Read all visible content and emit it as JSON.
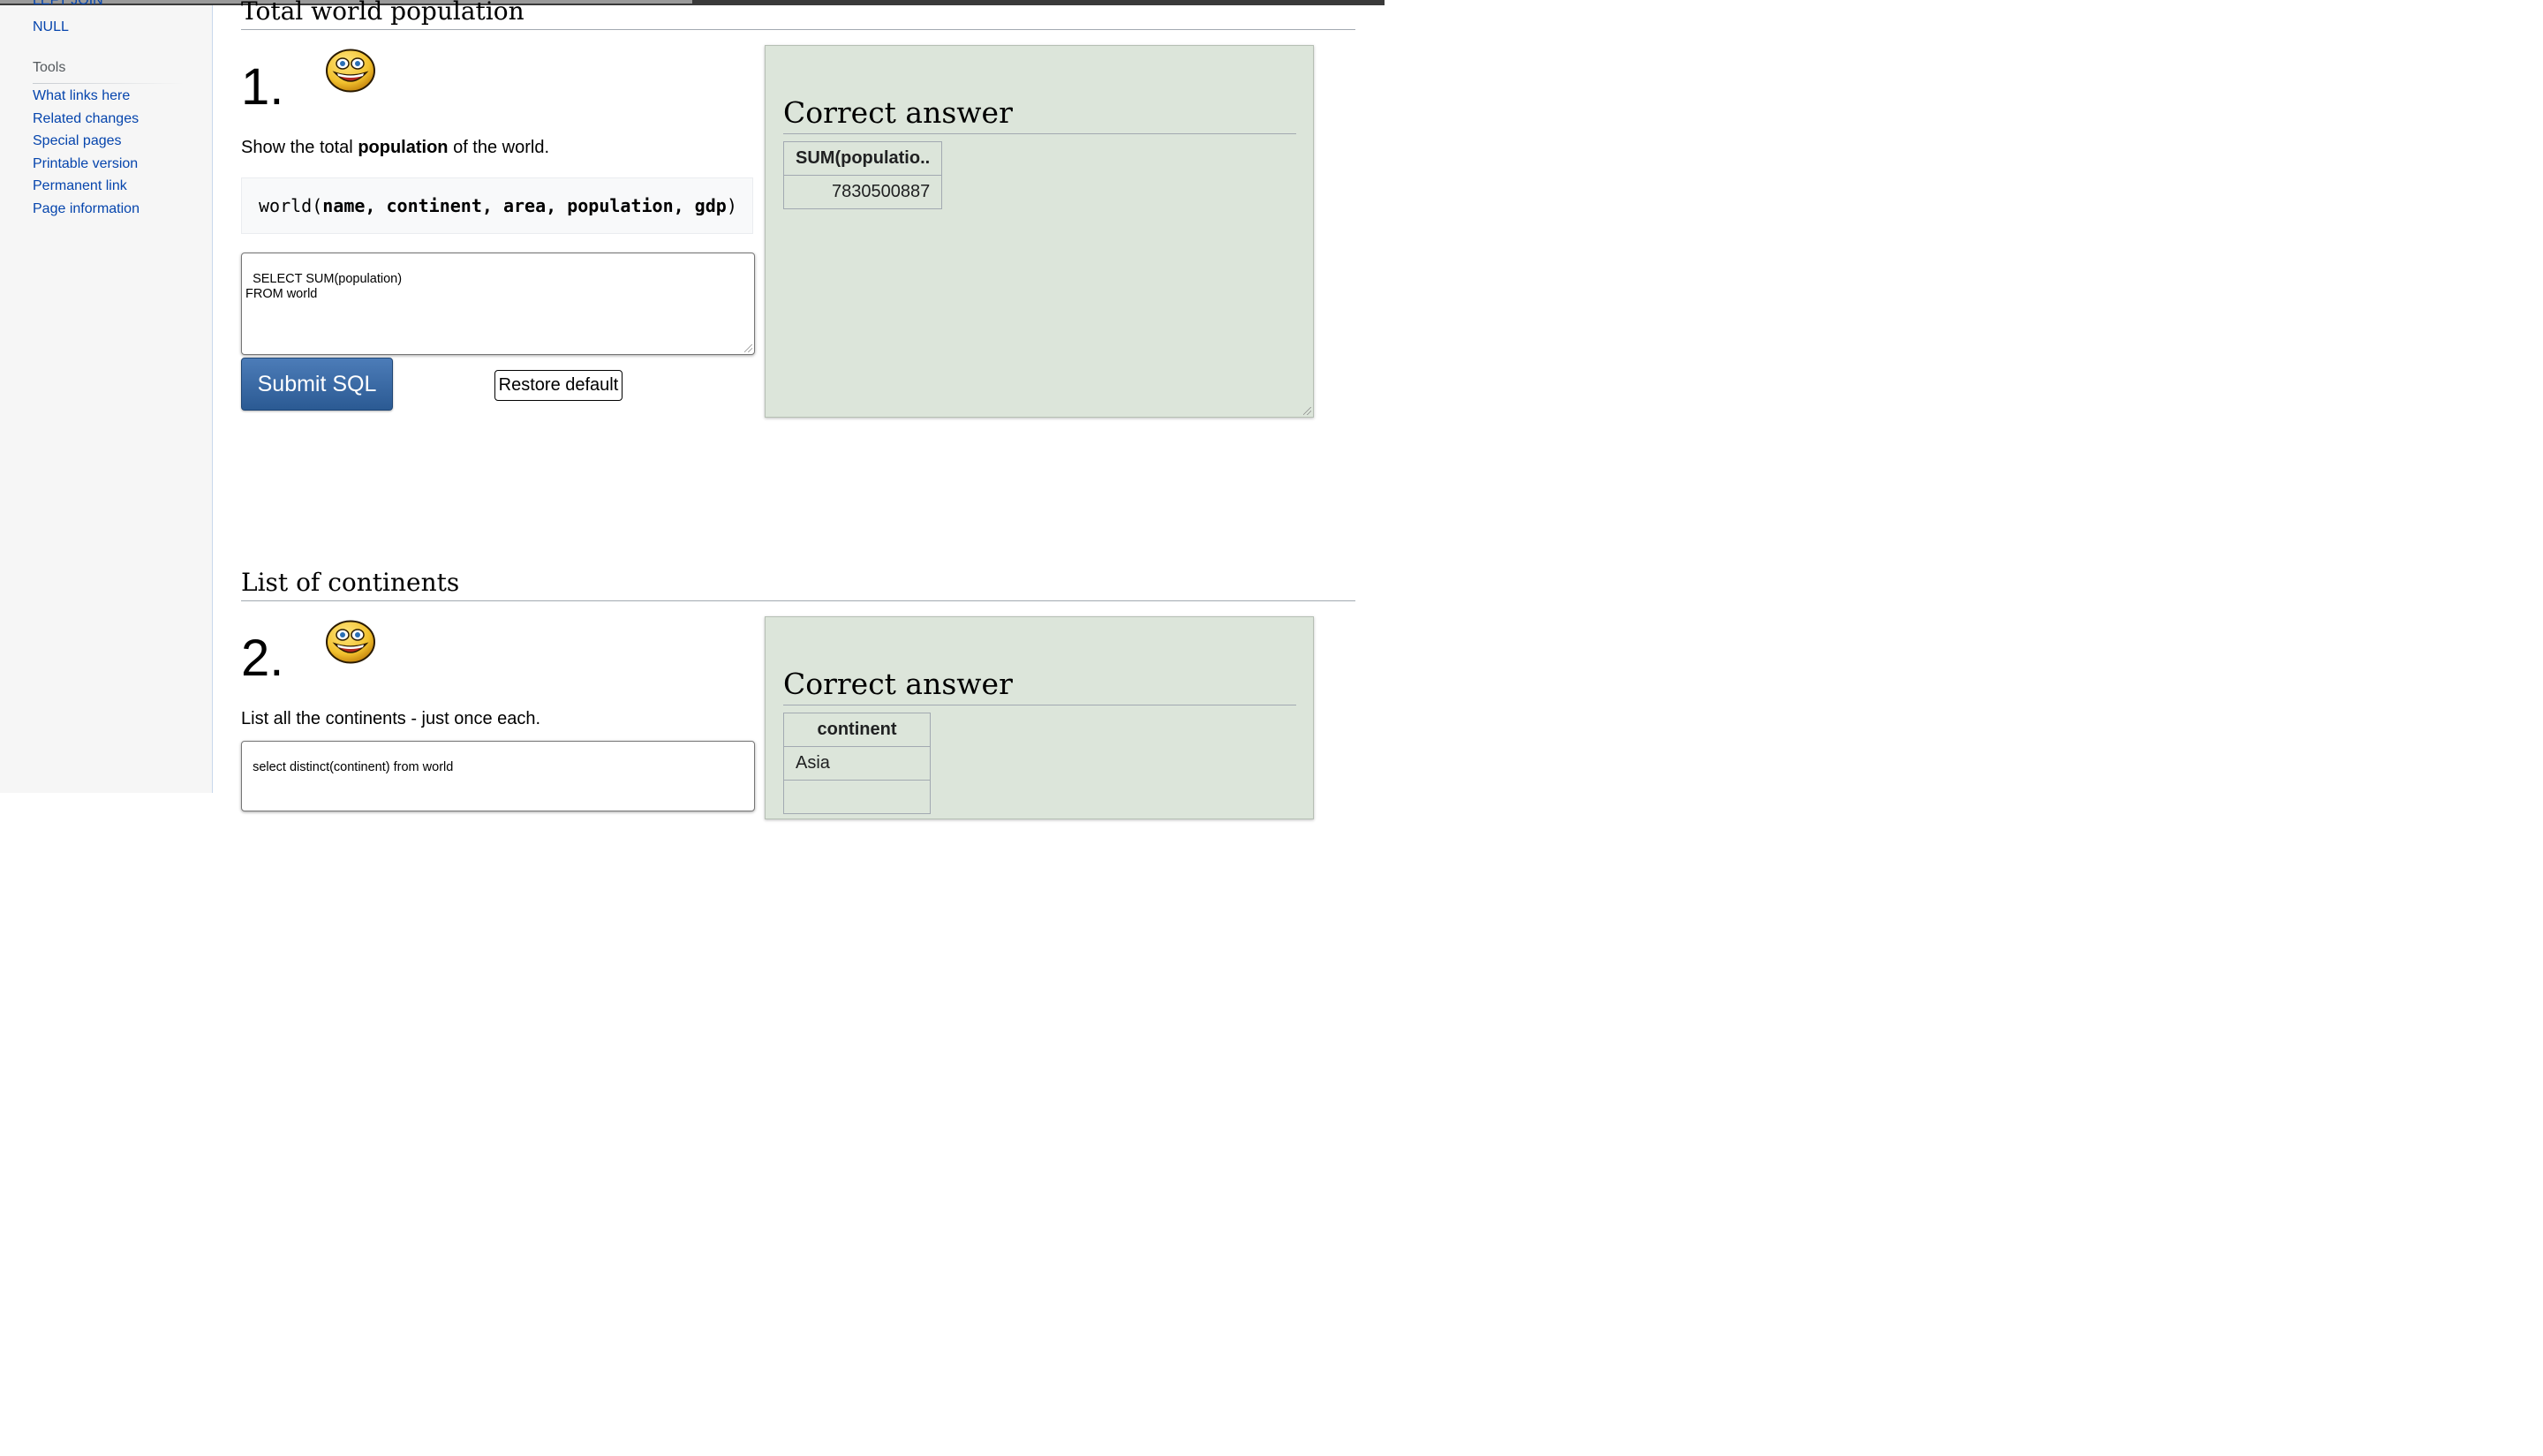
{
  "sidebar": {
    "cut_item": "LEFT JOIN",
    "null_item": "NULL",
    "tools_heading": "Tools",
    "tools": [
      "What links here",
      "Related changes",
      "Special pages",
      "Printable version",
      "Permanent link",
      "Page information"
    ]
  },
  "q1": {
    "section_title": "Total world population",
    "number": "1.",
    "prompt_pre": "Show the total ",
    "prompt_bold": "population",
    "prompt_post": " of the world.",
    "schema_table": "world(",
    "schema_cols": "name, continent, area, population, gdp",
    "schema_close": ")",
    "sql": "SELECT SUM(population)\nFROM world",
    "submit_label": "Submit SQL",
    "restore_label": "Restore default",
    "answer_title": "Correct answer",
    "answer_header": "SUM(populatio..",
    "answer_value": "7830500887"
  },
  "q2": {
    "section_title": "List of continents",
    "number": "2.",
    "prompt": "List all the continents - just once each.",
    "sql": "select distinct(continent) from world",
    "answer_title": "Correct answer",
    "answer_header": "continent",
    "answer_rows": [
      "Asia"
    ]
  },
  "colors": {
    "link": "#0645ad",
    "answer_bg": "#dce5da",
    "submit_bg": "#2b5a93",
    "smiley": "#f2c12e"
  }
}
